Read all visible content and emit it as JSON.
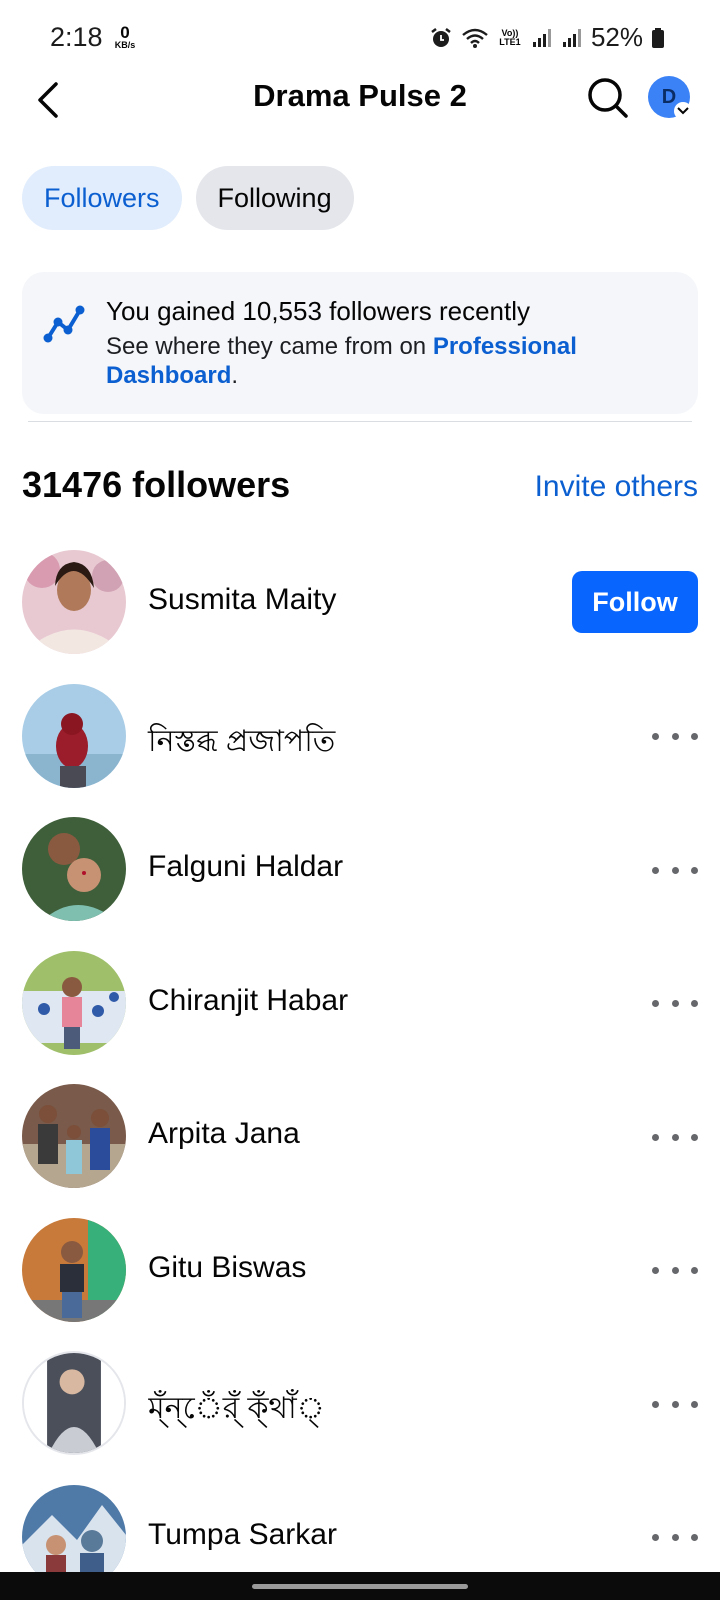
{
  "status_bar": {
    "time": "2:18",
    "net_speed_value": "0",
    "net_speed_unit": "KB/s",
    "lte_label": "Vo)) LTE1",
    "battery": "52%"
  },
  "header": {
    "title": "Drama Pulse 2",
    "avatar_initial": "D"
  },
  "tabs": [
    {
      "label": "Followers",
      "active": true
    },
    {
      "label": "Following",
      "active": false
    }
  ],
  "info_card": {
    "title": "You gained 10,553 followers recently",
    "text": "See where they came from on ",
    "link": "Professional Dashboard",
    "suffix": "."
  },
  "followers_header": {
    "count": "31476 followers",
    "invite": "Invite others"
  },
  "followers": [
    {
      "name": "Susmita Maity",
      "action": "Follow"
    },
    {
      "name": "নিস্তব্ধ প্রজাপতি",
      "action": "more"
    },
    {
      "name": "Falguni Haldar",
      "action": "more"
    },
    {
      "name": "Chiranjit Habar",
      "action": "more"
    },
    {
      "name": "Arpita Jana",
      "action": "more"
    },
    {
      "name": "Gitu Biswas",
      "action": "more"
    },
    {
      "name": "ম্ঁন্েঁর্ঁ ক্ঁথাঁ্",
      "action": "more"
    },
    {
      "name": "Tumpa Sarkar",
      "action": "more"
    }
  ],
  "colors": {
    "accent": "#0866ff",
    "link": "#0b5fd0",
    "active_tab_bg": "#e1edfc"
  }
}
